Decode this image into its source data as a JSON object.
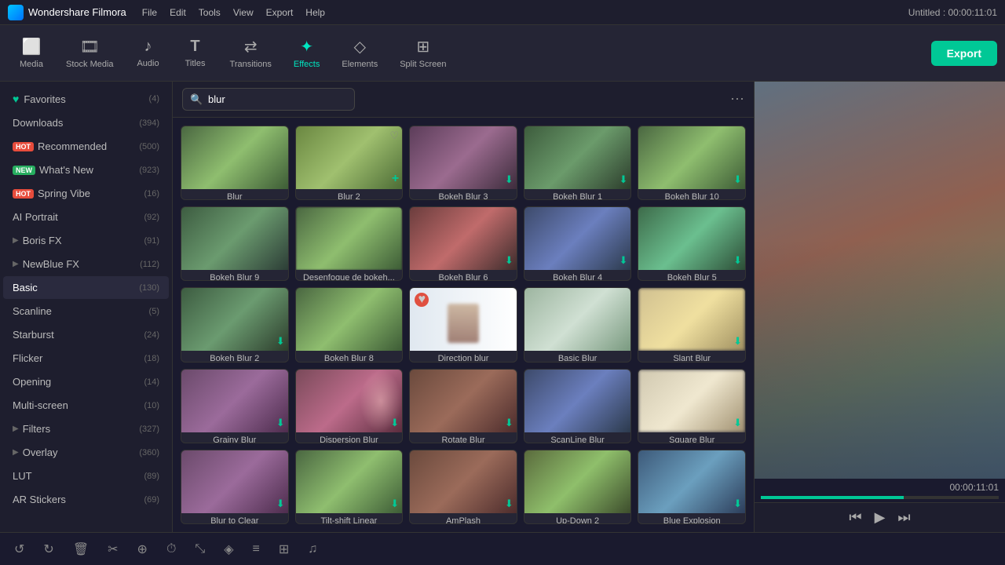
{
  "app": {
    "name": "Wondershare Filmora",
    "title": "Untitled : 00:00:11:01",
    "logo_icon": "🎬"
  },
  "menu": {
    "items": [
      "File",
      "Edit",
      "Tools",
      "View",
      "Export",
      "Help"
    ]
  },
  "toolbar": {
    "items": [
      {
        "id": "media",
        "label": "Media",
        "icon": "⬜"
      },
      {
        "id": "stock-media",
        "label": "Stock Media",
        "icon": "🎞"
      },
      {
        "id": "audio",
        "label": "Audio",
        "icon": "🎵"
      },
      {
        "id": "titles",
        "label": "Titles",
        "icon": "T"
      },
      {
        "id": "transitions",
        "label": "Transitions",
        "icon": "⟷"
      },
      {
        "id": "effects",
        "label": "Effects",
        "icon": "✨"
      },
      {
        "id": "elements",
        "label": "Elements",
        "icon": "◇"
      },
      {
        "id": "split-screen",
        "label": "Split Screen",
        "icon": "⊡"
      }
    ],
    "export_label": "Export",
    "active": "effects"
  },
  "sidebar": {
    "items": [
      {
        "id": "favorites",
        "label": "Favorites",
        "count": "(4)",
        "type": "fav",
        "badge": ""
      },
      {
        "id": "downloads",
        "label": "Downloads",
        "count": "(394)",
        "type": "normal",
        "badge": ""
      },
      {
        "id": "recommended",
        "label": "Recommended",
        "count": "(500)",
        "type": "normal",
        "badge": "HOT"
      },
      {
        "id": "whats-new",
        "label": "What's New",
        "count": "(923)",
        "type": "normal",
        "badge": "NEW"
      },
      {
        "id": "spring-vibe",
        "label": "Spring Vibe",
        "count": "(16)",
        "type": "normal",
        "badge": "HOT"
      },
      {
        "id": "ai-portrait",
        "label": "AI Portrait",
        "count": "(92)",
        "type": "normal",
        "badge": ""
      },
      {
        "id": "boris-fx",
        "label": "Boris FX",
        "count": "(91)",
        "type": "expand",
        "badge": ""
      },
      {
        "id": "newblue-fx",
        "label": "NewBlue FX",
        "count": "(112)",
        "type": "expand",
        "badge": ""
      },
      {
        "id": "basic",
        "label": "Basic",
        "count": "(130)",
        "type": "normal",
        "badge": ""
      },
      {
        "id": "scanline",
        "label": "Scanline",
        "count": "(5)",
        "type": "normal",
        "badge": ""
      },
      {
        "id": "starburst",
        "label": "Starburst",
        "count": "(24)",
        "type": "normal",
        "badge": ""
      },
      {
        "id": "flicker",
        "label": "Flicker",
        "count": "(18)",
        "type": "normal",
        "badge": ""
      },
      {
        "id": "opening",
        "label": "Opening",
        "count": "(14)",
        "type": "normal",
        "badge": ""
      },
      {
        "id": "multi-screen",
        "label": "Multi-screen",
        "count": "(10)",
        "type": "normal",
        "badge": ""
      },
      {
        "id": "filters",
        "label": "Filters",
        "count": "(327)",
        "type": "expand",
        "badge": ""
      },
      {
        "id": "overlay",
        "label": "Overlay",
        "count": "(360)",
        "type": "expand",
        "badge": ""
      },
      {
        "id": "lut",
        "label": "LUT",
        "count": "(89)",
        "type": "normal",
        "badge": ""
      },
      {
        "id": "ar-stickers",
        "label": "AR Stickers",
        "count": "(69)",
        "type": "normal",
        "badge": ""
      }
    ]
  },
  "search": {
    "placeholder": "blur",
    "value": "blur",
    "grid_toggle_title": "Grid view"
  },
  "effects": [
    {
      "id": "blur",
      "label": "Blur",
      "thumb": "blur",
      "has_dl": false
    },
    {
      "id": "blur2",
      "label": "Blur 2",
      "thumb": "blur2",
      "has_dl": false,
      "hovered": true
    },
    {
      "id": "bokeh-blur-3",
      "label": "Bokeh Blur 3",
      "thumb": "bokeh3",
      "has_dl": true
    },
    {
      "id": "bokeh-blur-1",
      "label": "Bokeh Blur 1",
      "thumb": "bokeh1",
      "has_dl": true
    },
    {
      "id": "bokeh-blur-10",
      "label": "Bokeh Blur 10",
      "thumb": "bokeh10",
      "has_dl": true
    },
    {
      "id": "bokeh-blur-9",
      "label": "Bokeh Blur 9",
      "thumb": "bokeh9",
      "has_dl": false
    },
    {
      "id": "desenfoque-bokeh",
      "label": "Desenfoque de bokeh...",
      "thumb": "desenfoque",
      "has_dl": false
    },
    {
      "id": "bokeh-blur-6",
      "label": "Bokeh Blur 6",
      "thumb": "bokeh6",
      "has_dl": true
    },
    {
      "id": "bokeh-blur-4",
      "label": "Bokeh Blur 4",
      "thumb": "bokeh4",
      "has_dl": true
    },
    {
      "id": "bokeh-blur-5",
      "label": "Bokeh Blur 5",
      "thumb": "bokeh5",
      "has_dl": true
    },
    {
      "id": "bokeh-blur-2",
      "label": "Bokeh Blur 2",
      "thumb": "bokeh2",
      "has_dl": true
    },
    {
      "id": "bokeh-blur-8",
      "label": "Bokeh Blur 8",
      "thumb": "bokeh8",
      "has_dl": false
    },
    {
      "id": "direction-blur",
      "label": "Direction blur",
      "thumb": "direction",
      "has_dl": false
    },
    {
      "id": "basic-blur",
      "label": "Basic Blur",
      "thumb": "basic",
      "has_dl": false
    },
    {
      "id": "slant-blur",
      "label": "Slant Blur",
      "thumb": "slant",
      "has_dl": true
    },
    {
      "id": "grainy-blur",
      "label": "Grainy Blur",
      "thumb": "grainy",
      "has_dl": true
    },
    {
      "id": "dispersion-blur",
      "label": "Dispersion Blur",
      "thumb": "dispersion",
      "has_dl": true
    },
    {
      "id": "rotate-blur",
      "label": "Rotate Blur",
      "thumb": "rotate",
      "has_dl": true
    },
    {
      "id": "scanline-blur",
      "label": "ScanLine Blur",
      "thumb": "scanline",
      "has_dl": false
    },
    {
      "id": "square-blur",
      "label": "Square Blur",
      "thumb": "square",
      "has_dl": true
    },
    {
      "id": "blur-to-clear",
      "label": "Blur to Clear",
      "thumb": "blurtoclear",
      "has_dl": true
    },
    {
      "id": "tiltshift-linear",
      "label": "Tilt-shift Linear",
      "thumb": "tiltshift",
      "has_dl": true
    },
    {
      "id": "amplash",
      "label": "AmPlash",
      "thumb": "amplash",
      "has_dl": true
    },
    {
      "id": "up-down-2",
      "label": "Up-Down 2",
      "thumb": "updown",
      "has_dl": false
    },
    {
      "id": "blue-explosion",
      "label": "Blue Explosion",
      "thumb": "blueexp",
      "has_dl": true
    }
  ],
  "preview": {
    "time": "00:00:11:01",
    "progress_pct": 60,
    "controls": {
      "prev": "⏮",
      "play": "▶",
      "next": "⏭"
    }
  },
  "bottom_toolbar": {
    "buttons": [
      "↺",
      "↻",
      "🗑",
      "✂",
      "⊕",
      "⏱",
      "⤡",
      "◈",
      "≡",
      "⌗",
      "⎋"
    ]
  }
}
